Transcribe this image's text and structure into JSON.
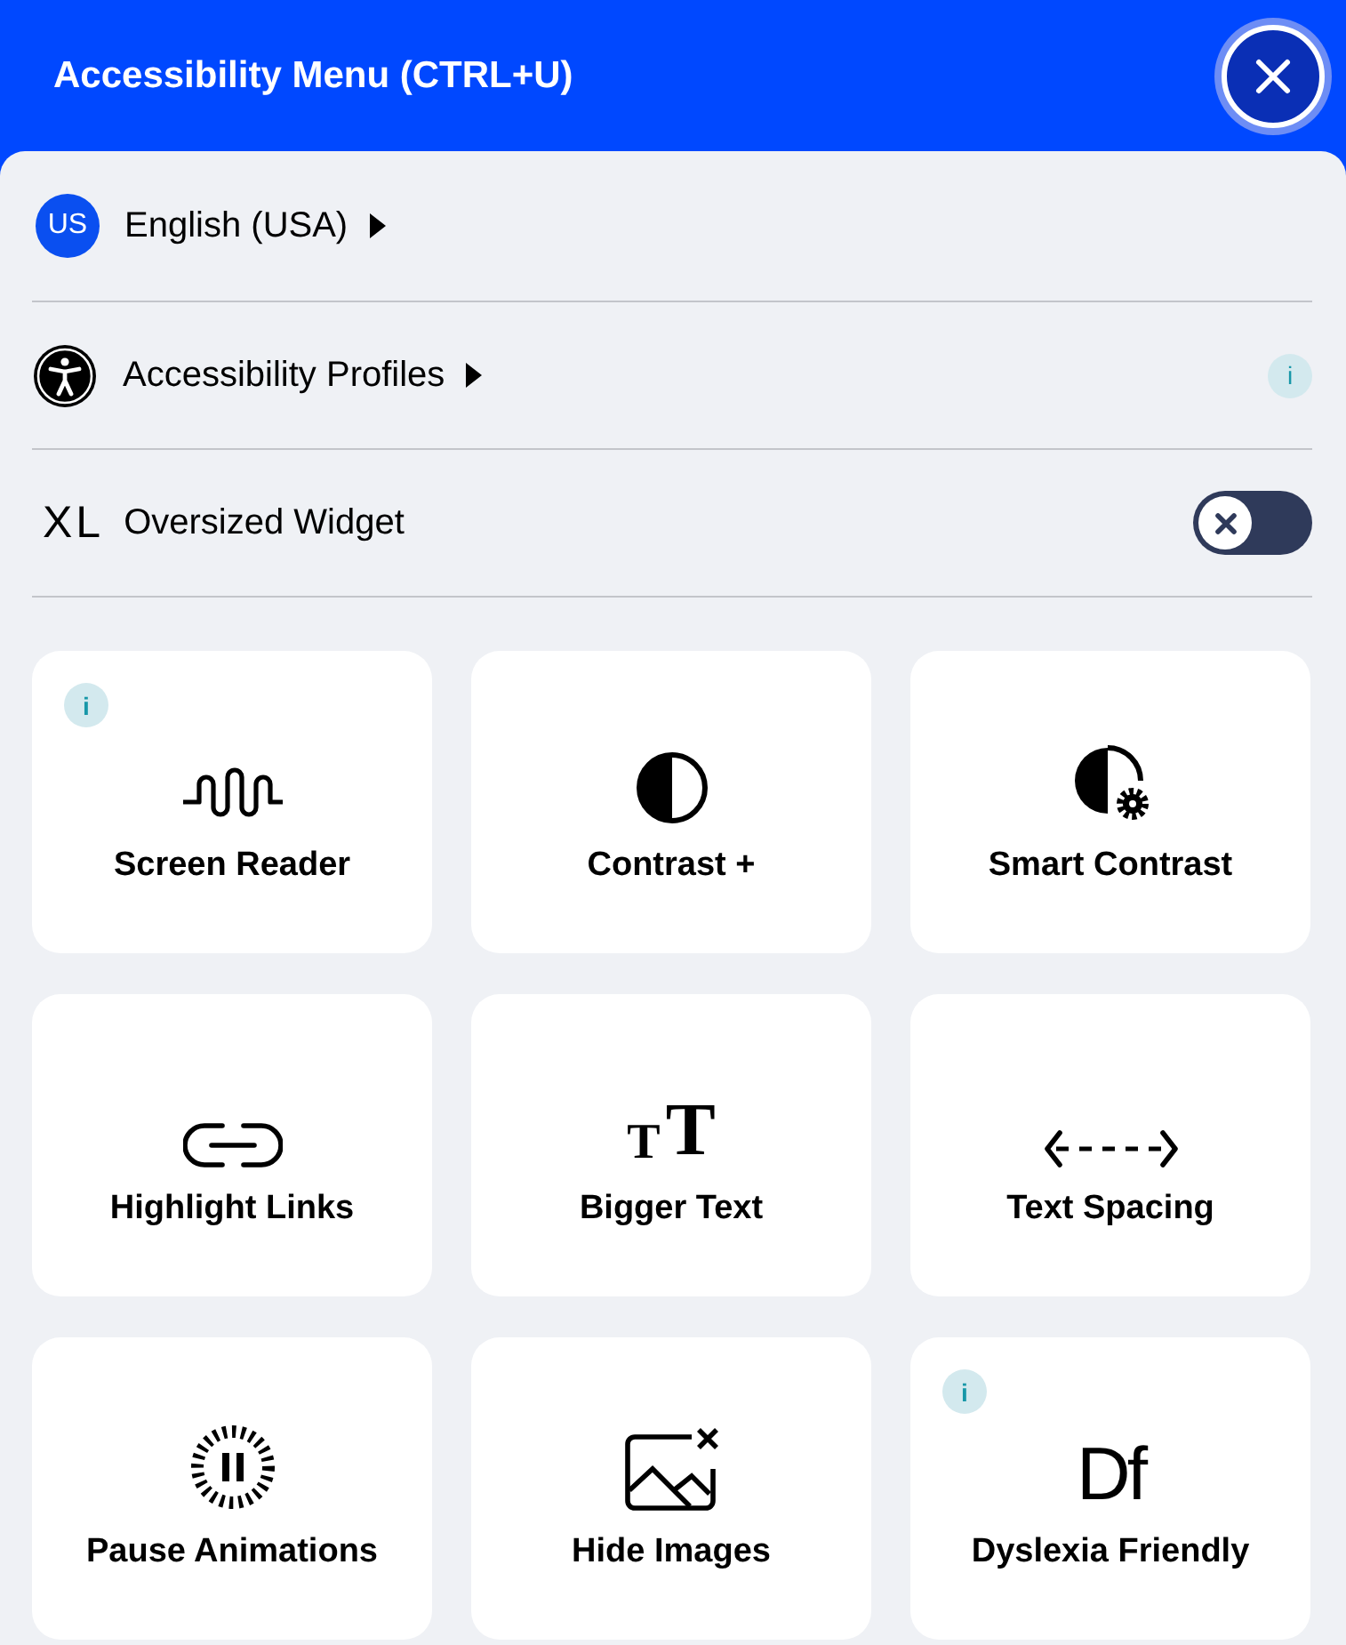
{
  "header": {
    "title": "Accessibility Menu (CTRL+U)"
  },
  "rows": [
    {
      "kind": "language",
      "badge": "US",
      "label": "English (USA)"
    },
    {
      "kind": "profiles",
      "label": "Accessibility Profiles",
      "info": "i"
    },
    {
      "kind": "toggle",
      "badge": "XL",
      "label": "Oversized Widget",
      "on": false
    }
  ],
  "tiles": [
    {
      "kind": "wave",
      "label": "Screen Reader",
      "info": "i"
    },
    {
      "kind": "contrast",
      "label": "Contrast +"
    },
    {
      "kind": "smart",
      "label": "Smart Contrast"
    },
    {
      "kind": "link",
      "label": "Highlight Links"
    },
    {
      "kind": "textsize",
      "glyphs": [
        "T",
        "T"
      ],
      "label": "Bigger Text"
    },
    {
      "kind": "spacing",
      "label": "Text Spacing"
    },
    {
      "kind": "pause",
      "label": "Pause Animations"
    },
    {
      "kind": "hideimage",
      "label": "Hide Images"
    },
    {
      "kind": "font",
      "glyphs": [
        "Df"
      ],
      "label": "Dyslexia Friendly",
      "info": "i"
    }
  ]
}
